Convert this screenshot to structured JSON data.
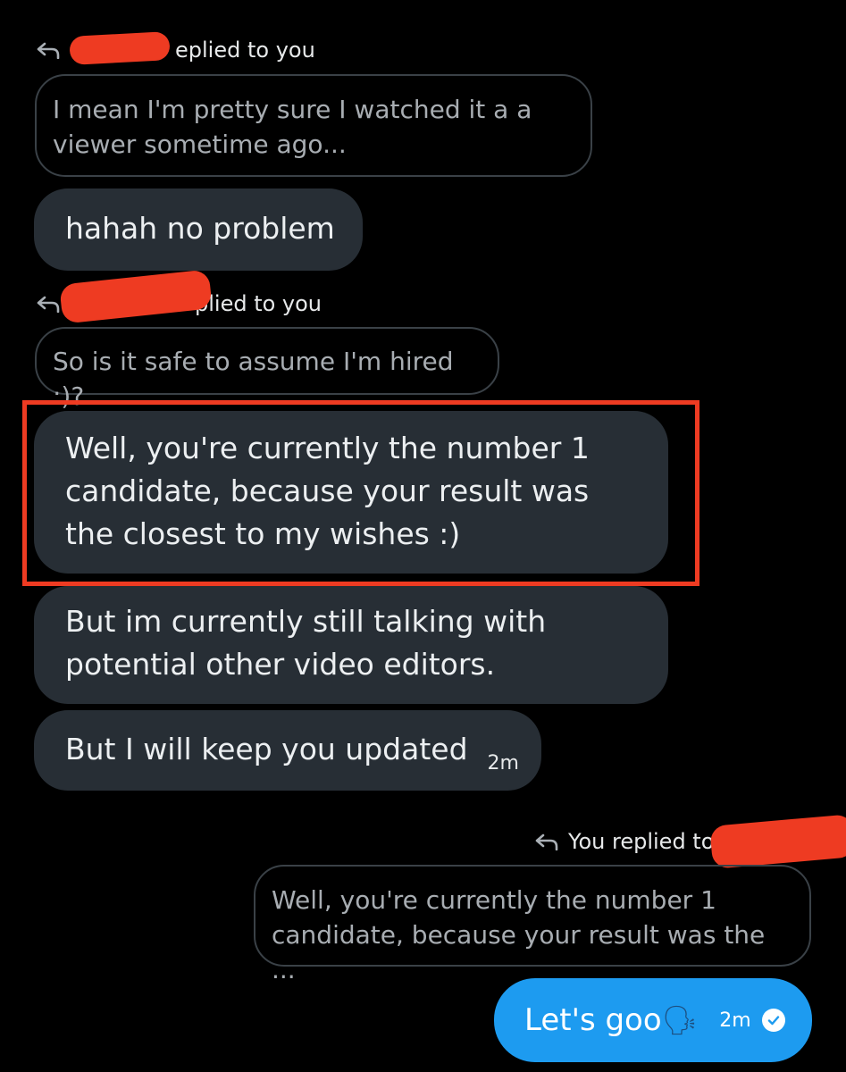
{
  "thread": {
    "reply_label_1": "eplied to you",
    "quote_1": "I mean I'm pretty sure I watched it a a viewer sometime ago...",
    "msg_1": "hahah no problem",
    "reply_label_2": "plied to you",
    "quote_2": "So is it safe to assume I'm hired :)?",
    "msg_2": "Well, you're currently the number 1 candidate, because your result was the closest to my wishes :)",
    "msg_3": "But im currently still talking with potential other video editors.",
    "msg_4": "But I will keep you updated",
    "msg_4_time": "2m",
    "reply_label_3": "You replied to",
    "quote_3": "Well, you're currently the number 1 candidate, because your result was the ...",
    "sent_msg": "Let's goo",
    "sent_emoji": "🗣",
    "sent_time": "2m"
  },
  "icons": {
    "reply": "reply-arrow-icon",
    "read_receipt": "check-circle-icon",
    "emoji": "speaking-head-emoji"
  },
  "colors": {
    "background": "#000000",
    "bubble_received": "#272e35",
    "bubble_sent": "#1d9bf0",
    "highlight": "#ee3b22"
  }
}
